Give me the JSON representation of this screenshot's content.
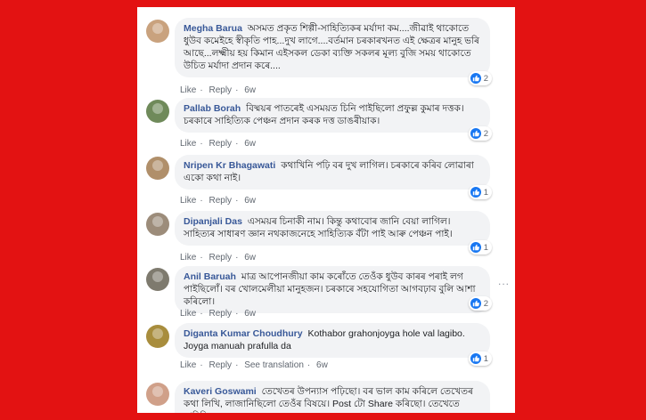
{
  "comments": [
    {
      "name": "Megha Barua",
      "text": "অসমত প্ৰকৃত শিল্পী-সাহিত্যিকৰ মৰ্যাদা কম....জীৱাই থাকোতে ধুউব কমেইহে স্বীকৃতি পাহ...দুখ লাগে....বৰ্তমান চৰকাৰখনত এই ক্ষেত্ৰৰ মানুহ ভৰি আছে...লক্ষ্মীয় হয় কিমান এইসকল ডেকা ব্যক্তি সকলৰ মূল্য বুজি সময় থাকোতে উচিত মৰ্যাদা প্ৰদান কৰে....",
      "like": "Like",
      "reply": "Reply",
      "time": "6w",
      "reactions": "2",
      "avatar_color": "#c9a27e"
    },
    {
      "name": "Pallab Borah",
      "text": "বিষ্ময়ৰ পাতৰেই এসময়ত চিনি পাইছিলো প্ৰফুল্ল কুমাৰ দত্তক। চৰকাৰে সাহিত্যিক পেঞ্চন প্ৰদান কৰক দত্ত ডাঙৰীয়াক।",
      "like": "Like",
      "reply": "Reply",
      "time": "6w",
      "reactions": "2",
      "avatar_color": "#6f8a5a"
    },
    {
      "name": "Nripen Kr Bhagawati",
      "text": "কথাখিনি পঢ়ি বৰ দুখ লাগিল। চৰকাৰে কৰিব লোৱাৰা একো কথা নাই।",
      "like": "Like",
      "reply": "Reply",
      "time": "6w",
      "reactions": "1",
      "avatar_color": "#b08f6a"
    },
    {
      "name": "Dipanjali Das",
      "text": "এসময়ৰ চিনাকী নাম। কিন্তু কথাবোৰ জানি বেয়া লাগিল। সাহিত্যৰ সাধাৰণ জ্ঞান নথকাজনেহে সাহিত্যিক বঁটা পাই আৰু পেঞ্চন পাই।",
      "like": "Like",
      "reply": "Reply",
      "time": "6w",
      "reactions": "1",
      "avatar_color": "#9c8c7a"
    },
    {
      "name": "Anil Baruah",
      "text": "মাত্ৰ আপোনজীয়া কাম কৰোঁতে তেওঁক ধুউব কাৰৰ পৰাই লগ পাইছিলোঁ। বৰ খোলমেলীয়া মানুহজন। চৰকাৰে সহযোগিতা আগবঢ়াব বুলি আশা কৰিলো।",
      "like": "Like",
      "reply": "Reply",
      "time": "6w",
      "reactions": "2",
      "avatar_color": "#7e7a6e"
    },
    {
      "name": "Diganta Kumar Choudhury",
      "text": "Kothabor grahonjoyga hole val lagibo. Joyga manuah prafulla da",
      "like": "Like",
      "reply": "Reply",
      "translate": "See translation",
      "time": "6w",
      "reactions": "1",
      "avatar_color": "#a88d3d"
    },
    {
      "name": "Kaveri Goswami",
      "text": "তেখেতৰ উপন্যাস পঢ়িছো। বৰ ভাল কাম কৰিলে তেখেতৰ কথা লিখি, লাজানিছিলো তেওঁৰ বিষয়ে। Post টো Share কৰিছো। তেখেতে সাহিত্যিক",
      "avatar_color": "#d0a089"
    }
  ],
  "more_options": "...",
  "colors": {
    "background": "#e31212",
    "name": "#385898",
    "like_blue": "#1877f2",
    "bubble": "#f2f3f5"
  }
}
